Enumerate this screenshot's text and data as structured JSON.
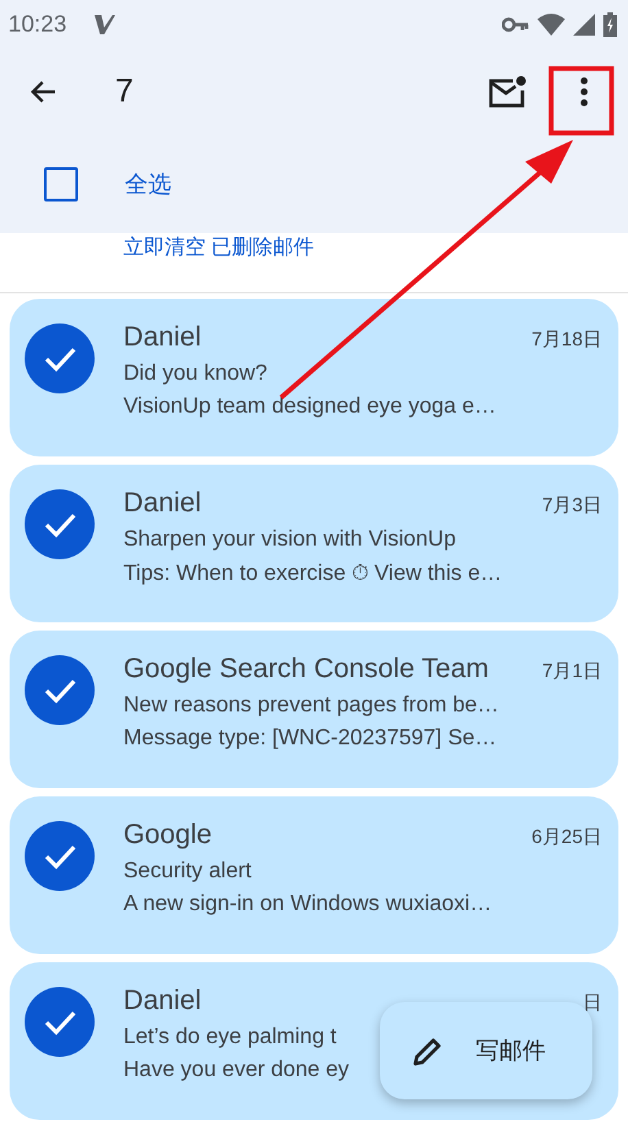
{
  "status_bar": {
    "time": "10:23"
  },
  "toolbar": {
    "count": "7"
  },
  "select_all": {
    "label": "全选",
    "checked": false
  },
  "banner_link": "立即清空 已删除邮件",
  "messages": [
    {
      "sender": "Daniel",
      "date": "7月18日",
      "subject": "Did you know?",
      "snippet": "VisionUp team designed eye yoga e…",
      "selected": true
    },
    {
      "sender": "Daniel",
      "date": "7月3日",
      "subject": "Sharpen your vision with VisionUp",
      "snippet": "Tips: When to exercise ⏱ View this e…",
      "selected": true
    },
    {
      "sender": "Google Search Console Team",
      "date": "7月1日",
      "subject": "New reasons prevent pages from be…",
      "snippet": "Message type: [WNC-20237597] Se…",
      "selected": true
    },
    {
      "sender": "Google",
      "date": "6月25日",
      "subject": "Security alert",
      "snippet": "A new sign-in on Windows wuxiaoxi…",
      "selected": true
    },
    {
      "sender": "Daniel",
      "date": "日",
      "subject": "Let’s do eye palming t",
      "snippet": "Have you ever done ey",
      "selected": true
    }
  ],
  "compose_button": {
    "label": "写邮件"
  }
}
